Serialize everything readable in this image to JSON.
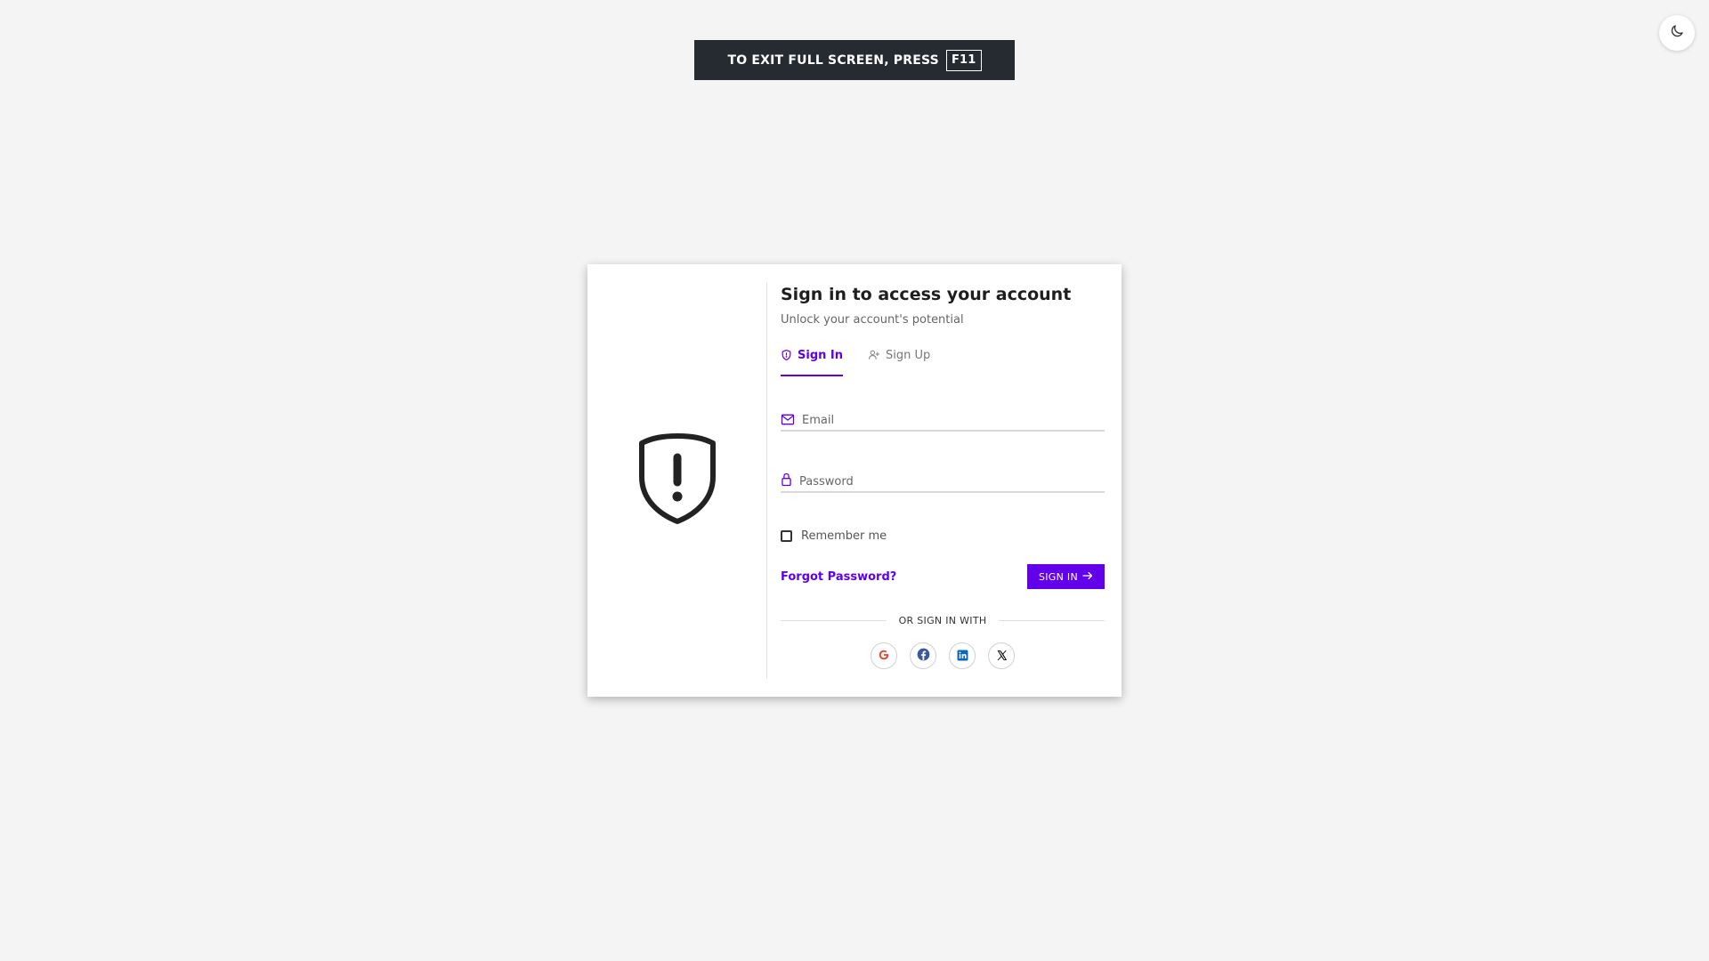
{
  "banner": {
    "text": "TO EXIT FULL SCREEN, PRESS",
    "key": "F11"
  },
  "theme": {
    "icon": "moon-icon"
  },
  "login": {
    "title": "Sign in to access your account",
    "subtitle": "Unlock your account's potential",
    "tabs": [
      {
        "label": "Sign In",
        "icon": "shield-icon",
        "active": true
      },
      {
        "label": "Sign Up",
        "icon": "user-plus-icon",
        "active": false
      }
    ],
    "email": {
      "placeholder": "Email",
      "value": "",
      "icon": "mail-icon"
    },
    "password": {
      "placeholder": "Password",
      "value": "",
      "icon": "lock-icon"
    },
    "remember_label": "Remember me",
    "remember_checked": false,
    "forgot_label": "Forgot Password?",
    "signin_label": "SIGN IN",
    "or_label": "OR SIGN IN WITH",
    "socials": [
      {
        "name": "google-icon",
        "color": "#ea4335"
      },
      {
        "name": "facebook-icon",
        "color": "#3b5998"
      },
      {
        "name": "linkedin-icon",
        "color": "#0a66c2"
      },
      {
        "name": "x-icon",
        "color": "#000000"
      }
    ]
  },
  "colors": {
    "accent": "#6200ea",
    "banner_bg": "#262a31",
    "page_bg": "#f4f4f4"
  }
}
